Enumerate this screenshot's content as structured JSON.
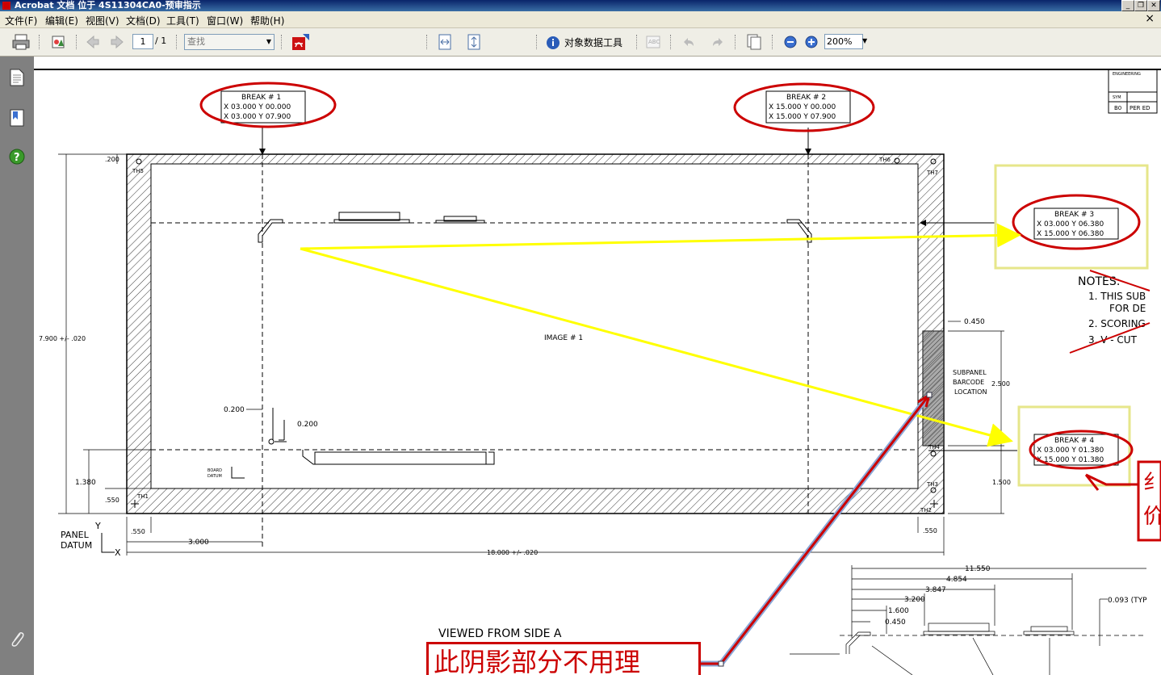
{
  "window": {
    "title": "Acrobat 文档 位于 4S11304CA0-预审指示"
  },
  "menu": [
    "文件(F)",
    "编辑(E)",
    "视图(V)",
    "文档(D)",
    "工具(T)",
    "窗口(W)",
    "帮助(H)"
  ],
  "toolbar": {
    "page_current": "1",
    "page_total": "/ 1",
    "find_placeholder": "查找",
    "object_data_tool": "对象数据工具",
    "zoom": "200%"
  },
  "drawing": {
    "breaks": [
      {
        "title": "BREAK # 1",
        "line1": "X 03.000 Y 00.000",
        "line2": "X 03.000 Y 07.900"
      },
      {
        "title": "BREAK # 2",
        "line1": "X 15.000 Y 00.000",
        "line2": "X 15.000 Y 07.900"
      },
      {
        "title": "BREAK # 3",
        "line1": "X 03.000 Y 06.380",
        "line2": "X 15.000 Y 06.380"
      },
      {
        "title": "BREAK # 4",
        "line1": "X 03.000 Y 01.380",
        "line2": "X 15.000 Y 01.380"
      }
    ],
    "image_label": "IMAGE # 1",
    "holes": [
      "TH5",
      "TH6",
      "TH7",
      "TH1",
      "TH2",
      "TH3",
      "TH4"
    ],
    "dims": {
      "top_offset": ".200",
      "height": "7.900 +/- .020",
      "width": "18.000 +/- .020",
      "x3": "3.000",
      "y1380": "1.380",
      "left550": ".550",
      "bottom550": ".550",
      "right550": ".550",
      "d0200a": "0.200",
      "d0200b": "0.200",
      "d0450": "0.450",
      "d2500": "2.500",
      "d1500": "1.500"
    },
    "subpanel": [
      "SUBPANEL",
      "BARCODE",
      "LOCATION"
    ],
    "board_datum": [
      "BOARD",
      "DATUM"
    ],
    "panel_datum": [
      "PANEL",
      "DATUM"
    ],
    "axis_y": "Y",
    "axis_x": "X",
    "notes": {
      "title": "NOTES:",
      "items": [
        "1.  THIS SUB",
        "FOR DE",
        "2.  SCORING",
        "3.  V - CUT"
      ]
    },
    "title_block": {
      "eng": "ENGINEERING",
      "sym": "SYM",
      "b0": "B0",
      "per": "PER ED"
    },
    "lower_dims": [
      "11.550",
      "4.854",
      "3.847",
      "3.200",
      "1.600",
      "0.450",
      "0.093 (TYP"
    ],
    "viewed_from": "VIEWED FROM SIDE A",
    "red_side_chars": [
      "纟",
      "价"
    ]
  },
  "annotation": {
    "callout_text": "此阴影部分不用理"
  },
  "colors": {
    "annotation_red": "#cc0000",
    "arrow_yellow": "#ffff00",
    "highlight_box": "#e6e68a",
    "drawing_line": "#000000"
  }
}
